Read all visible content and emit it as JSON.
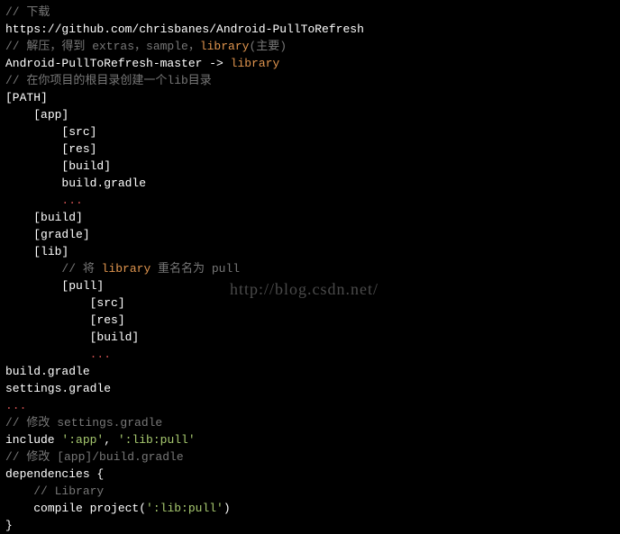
{
  "lines": [
    {
      "segs": [
        {
          "t": "// 下载",
          "cls": "c-comment"
        }
      ]
    },
    {
      "segs": [
        {
          "t": "https://github.com/chrisbanes/Android-PullToRefresh",
          "cls": "c-white"
        }
      ]
    },
    {
      "segs": [
        {
          "t": "// 解压，得到 extras，sample，",
          "cls": "c-comment"
        },
        {
          "t": "library",
          "cls": "c-orange"
        },
        {
          "t": "(主要)",
          "cls": "c-comment"
        }
      ]
    },
    {
      "segs": [
        {
          "t": "Android-PullToRefresh-master -> ",
          "cls": "c-white"
        },
        {
          "t": "library",
          "cls": "c-orange"
        }
      ]
    },
    {
      "segs": [
        {
          "t": "// 在你项目的根目录创建一个lib目录",
          "cls": "c-comment"
        }
      ]
    },
    {
      "segs": [
        {
          "t": "[PATH]",
          "cls": "c-white"
        }
      ]
    },
    {
      "segs": [
        {
          "t": "[app]",
          "cls": "c-white"
        }
      ],
      "indent": 1
    },
    {
      "segs": [
        {
          "t": "[src]",
          "cls": "c-white"
        }
      ],
      "indent": 2
    },
    {
      "segs": [
        {
          "t": "[res]",
          "cls": "c-white"
        }
      ],
      "indent": 2
    },
    {
      "segs": [
        {
          "t": "[build]",
          "cls": "c-white"
        }
      ],
      "indent": 2
    },
    {
      "segs": [
        {
          "t": "build.gradle",
          "cls": "c-white"
        }
      ],
      "indent": 2
    },
    {
      "segs": [
        {
          "t": "...",
          "cls": "c-red"
        }
      ],
      "indent": 2
    },
    {
      "segs": [
        {
          "t": "[build]",
          "cls": "c-white"
        }
      ],
      "indent": 1
    },
    {
      "segs": [
        {
          "t": "[gradle]",
          "cls": "c-white"
        }
      ],
      "indent": 1
    },
    {
      "segs": [
        {
          "t": "[lib]",
          "cls": "c-white"
        }
      ],
      "indent": 1
    },
    {
      "segs": [
        {
          "t": "// 将 ",
          "cls": "c-comment"
        },
        {
          "t": "library",
          "cls": "c-orange"
        },
        {
          "t": " 重名名为 pull",
          "cls": "c-comment"
        }
      ],
      "indent": 2
    },
    {
      "segs": [
        {
          "t": "[pull]",
          "cls": "c-white"
        }
      ],
      "indent": 2
    },
    {
      "segs": [
        {
          "t": "[src]",
          "cls": "c-white"
        }
      ],
      "indent": 3
    },
    {
      "segs": [
        {
          "t": "[res]",
          "cls": "c-white"
        }
      ],
      "indent": 3
    },
    {
      "segs": [
        {
          "t": "[build]",
          "cls": "c-white"
        }
      ],
      "indent": 3
    },
    {
      "segs": [
        {
          "t": "...",
          "cls": "c-red"
        }
      ],
      "indent": 3
    },
    {
      "segs": [
        {
          "t": "build.gradle",
          "cls": "c-white"
        }
      ]
    },
    {
      "segs": [
        {
          "t": "settings.gradle",
          "cls": "c-white"
        }
      ]
    },
    {
      "segs": [
        {
          "t": "...",
          "cls": "c-red"
        }
      ]
    },
    {
      "segs": [
        {
          "t": "// 修改 settings.gradle",
          "cls": "c-comment"
        }
      ]
    },
    {
      "segs": [
        {
          "t": "include ",
          "cls": "c-white"
        },
        {
          "t": "':app'",
          "cls": "c-green"
        },
        {
          "t": ", ",
          "cls": "c-white"
        },
        {
          "t": "':lib:pull'",
          "cls": "c-green"
        }
      ]
    },
    {
      "segs": [
        {
          "t": "// 修改 [app]/build.gradle",
          "cls": "c-comment"
        }
      ]
    },
    {
      "segs": [
        {
          "t": "dependencies {",
          "cls": "c-white"
        }
      ]
    },
    {
      "segs": [
        {
          "t": "// Library",
          "cls": "c-comment"
        }
      ],
      "indent": 1
    },
    {
      "segs": [
        {
          "t": "compile project(",
          "cls": "c-white"
        },
        {
          "t": "':lib:pull'",
          "cls": "c-green"
        },
        {
          "t": ")",
          "cls": "c-white"
        }
      ],
      "indent": 1
    },
    {
      "segs": [
        {
          "t": "}",
          "cls": "c-white"
        }
      ]
    }
  ],
  "watermark": "http://blog.csdn.net/"
}
